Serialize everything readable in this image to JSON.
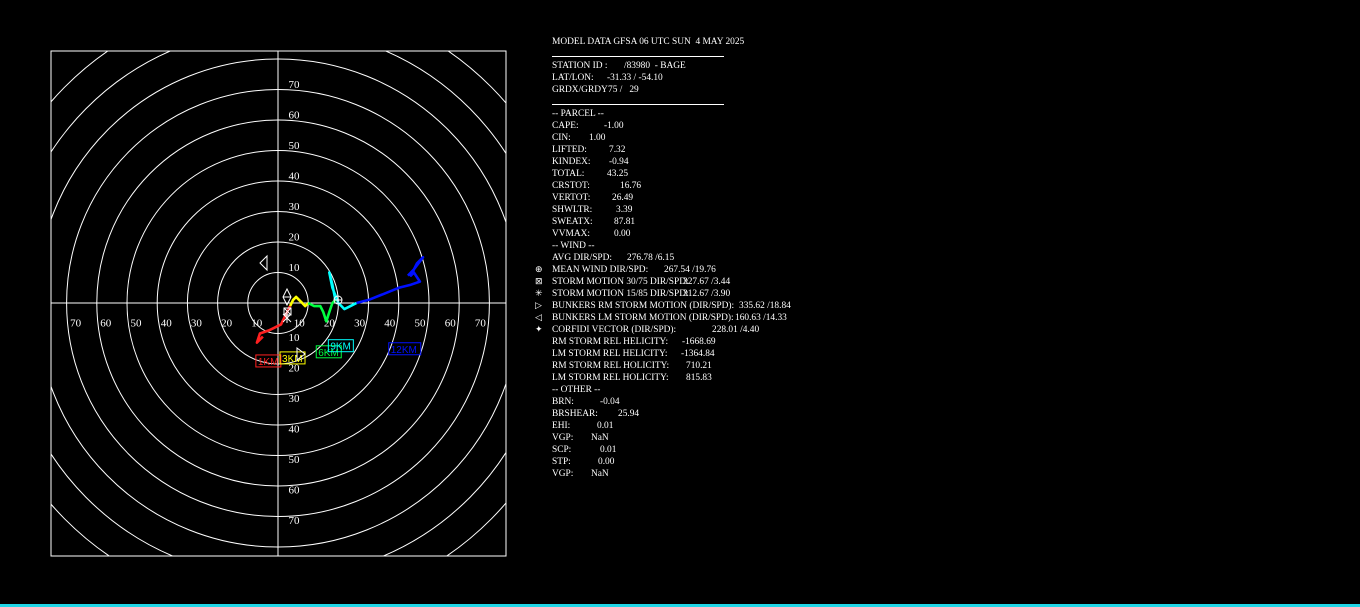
{
  "chart_data": {
    "type": "hodograph",
    "rings": [
      10,
      20,
      30,
      40,
      50,
      60,
      70
    ],
    "ring_labels": [
      "10",
      "20",
      "30",
      "40",
      "50",
      "60",
      "70"
    ],
    "hodograph_segments": [
      {
        "label": "1KM",
        "color": "#ff2020",
        "points": [
          [
            -5,
            -11
          ],
          [
            -7,
            -13
          ],
          [
            -6,
            -10
          ],
          [
            -3,
            -9
          ],
          [
            -1,
            -8
          ],
          [
            1,
            -7
          ],
          [
            2,
            -5
          ],
          [
            3,
            -3
          ],
          [
            4,
            -1
          ]
        ]
      },
      {
        "label": "3KM",
        "color": "#ffff00",
        "points": [
          [
            4,
            -1
          ],
          [
            5,
            1
          ],
          [
            6,
            2
          ],
          [
            7,
            1
          ],
          [
            8,
            0
          ],
          [
            9,
            -1
          ],
          [
            10,
            0
          ]
        ]
      },
      {
        "label": "6KM",
        "color": "#00ff40",
        "points": [
          [
            10,
            0
          ],
          [
            12,
            -1
          ],
          [
            14,
            -1
          ],
          [
            15,
            -3
          ],
          [
            16,
            -6
          ],
          [
            17,
            -3
          ],
          [
            18,
            0
          ],
          [
            19,
            1
          ]
        ]
      },
      {
        "label": "9KM",
        "color": "#00ffff",
        "points": [
          [
            19,
            1
          ],
          [
            18,
            6
          ],
          [
            17,
            10
          ],
          [
            18,
            5
          ],
          [
            20,
            0
          ],
          [
            22,
            -2
          ],
          [
            24,
            -1
          ],
          [
            26,
            0
          ]
        ]
      },
      {
        "label": "12KM",
        "color": "#0010ff",
        "points": [
          [
            26,
            0
          ],
          [
            30,
            1
          ],
          [
            35,
            3
          ],
          [
            40,
            5
          ],
          [
            44,
            6
          ],
          [
            47,
            7
          ],
          [
            45,
            10
          ],
          [
            44,
            9
          ],
          [
            46,
            13
          ],
          [
            48,
            15
          ],
          [
            45,
            11
          ],
          [
            43,
            9
          ]
        ]
      }
    ],
    "level_labels": [
      {
        "text": "1KM",
        "color": "#ff2020",
        "x": -7,
        "y": -19
      },
      {
        "text": "3KM",
        "color": "#ffff00",
        "x": 1,
        "y": -18
      },
      {
        "text": "6KM",
        "color": "#00ff40",
        "x": 13,
        "y": -16
      },
      {
        "text": "9KM",
        "color": "#00ffff",
        "x": 17,
        "y": -14
      },
      {
        "text": "12KM",
        "color": "#0010ff",
        "x": 37,
        "y": -15
      }
    ]
  },
  "panel": {
    "title": "MODEL DATA GFSA 06 UTC SUN  4 MAY 2025",
    "station_label": "STATION ID :",
    "station_value": "/83980  - BAGE",
    "latlon_label": "LAT/LON:",
    "latlon_value": "-31.33 / -54.10",
    "grd_label": "GRDX/GRDY",
    "grd_value": "75 /   29",
    "parcel_header": "-- PARCEL --",
    "parcel": [
      {
        "label": "CAPE:",
        "value": "-1.00"
      },
      {
        "label": "CIN:",
        "value": "1.00"
      },
      {
        "label": "LIFTED:",
        "value": "7.32"
      },
      {
        "label": "KINDEX:",
        "value": "-0.94"
      },
      {
        "label": "TOTAL:",
        "value": "43.25"
      },
      {
        "label": "CRSTOT:",
        "value": "16.76"
      },
      {
        "label": "VERTOT:",
        "value": "26.49"
      },
      {
        "label": "SHWLTR:",
        "value": "3.39"
      },
      {
        "label": "SWEATX:",
        "value": "87.81"
      },
      {
        "label": "VVMAX:",
        "value": "0.00"
      }
    ],
    "wind_header": "-- WIND --",
    "wind": [
      {
        "label": "AVG DIR/SPD:",
        "value": "276.78 /6.15",
        "symbol": ""
      },
      {
        "label": "MEAN WIND DIR/SPD:",
        "value": "267.54 /19.76",
        "symbol": "⊕"
      },
      {
        "label": "STORM MOTION 30/75 DIR/SPD:",
        "value": "327.67 /3.44",
        "symbol": "⊠"
      },
      {
        "label": "STORM MOTION 15/85 DIR/SPD:",
        "value": "312.67 /3.90",
        "symbol": "✳"
      },
      {
        "label": "BUNKERS RM STORM MOTION (DIR/SPD):",
        "value": "335.62 /18.84",
        "symbol": "▷"
      },
      {
        "label": "BUNKERS LM STORM MOTION (DIR/SPD):",
        "value": "160.63 /14.33",
        "symbol": "◁"
      },
      {
        "label": "CORFIDI VECTOR (DIR/SPD):",
        "value": "228.01 /4.40",
        "symbol": "✦"
      },
      {
        "label": "RM STORM REL HELICITY:",
        "value": "-1668.69",
        "symbol": ""
      },
      {
        "label": "LM STORM REL HELICITY:",
        "value": "-1364.84",
        "symbol": ""
      },
      {
        "label": "RM STORM REL HOLICITY:",
        "value": "710.21",
        "symbol": ""
      },
      {
        "label": "LM STORM REL HOLICITY:",
        "value": "815.83",
        "symbol": ""
      }
    ],
    "other_header": "-- OTHER --",
    "other": [
      {
        "label": "BRN:",
        "value": "-0.04"
      },
      {
        "label": "BRSHEAR:",
        "value": "25.94"
      },
      {
        "label": "EHI:",
        "value": "0.01"
      },
      {
        "label": "VGP:",
        "value": "NaN"
      },
      {
        "label": "SCP:",
        "value": "0.01"
      },
      {
        "label": "STP:",
        "value": "0.00"
      },
      {
        "label": "VGP:",
        "value": "NaN"
      }
    ]
  }
}
